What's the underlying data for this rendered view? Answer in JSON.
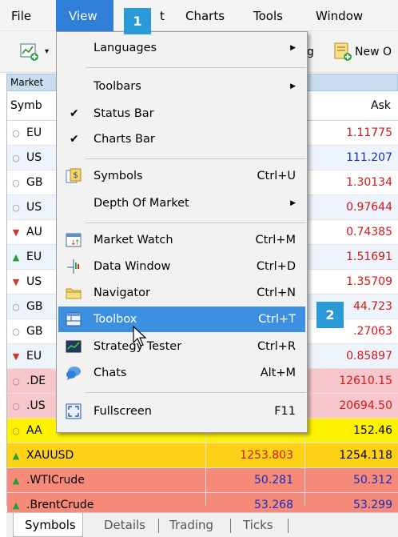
{
  "menubar": {
    "items": [
      "File",
      "View",
      "t",
      "Charts",
      "Tools",
      "Window"
    ]
  },
  "toolbar": {
    "partial_text": "g",
    "new_order_label": "New O"
  },
  "market_watch": {
    "title": "Market",
    "columns": [
      "Symb",
      "Ask"
    ],
    "rows": [
      {
        "symbol": "EU",
        "bid": "",
        "ask": "1.11775",
        "dir": "neutral"
      },
      {
        "symbol": "US",
        "bid": "",
        "ask": "111.207",
        "dir": "neutral"
      },
      {
        "symbol": "GB",
        "bid": "",
        "ask": "1.30134",
        "dir": "neutral"
      },
      {
        "symbol": "US",
        "bid": "",
        "ask": "0.97644",
        "dir": "neutral"
      },
      {
        "symbol": "AU",
        "bid": "",
        "ask": "0.74385",
        "dir": "down"
      },
      {
        "symbol": "EU",
        "bid": "",
        "ask": "1.51691",
        "dir": "up"
      },
      {
        "symbol": "US",
        "bid": "",
        "ask": "1.35709",
        "dir": "down"
      },
      {
        "symbol": "GB",
        "bid": "",
        "ask": "44.723",
        "dir": "neutral"
      },
      {
        "symbol": "GB",
        "bid": "",
        "ask": ".27063",
        "dir": "neutral"
      },
      {
        "symbol": "EU",
        "bid": "",
        "ask": "0.85897",
        "dir": "down"
      },
      {
        "symbol": ".DE",
        "bid": "",
        "ask": "12610.15",
        "dir": "neutral"
      },
      {
        "symbol": ".US",
        "bid": "",
        "ask": "20694.50",
        "dir": "neutral"
      },
      {
        "symbol": "AA",
        "bid": "",
        "ask": "152.46",
        "dir": "neutral"
      },
      {
        "symbol": "XAUUSD",
        "bid": "1253.803",
        "ask": "1254.118",
        "dir": "up"
      },
      {
        "symbol": ".WTICrude",
        "bid": "50.281",
        "ask": "50.312",
        "dir": "up"
      },
      {
        "symbol": ".BrentCrude",
        "bid": "53.268",
        "ask": "53.299",
        "dir": "up"
      }
    ]
  },
  "tabs": [
    "Symbols",
    "Details",
    "Trading",
    "Ticks"
  ],
  "view_menu": {
    "items": [
      {
        "label": "Languages",
        "shortcut": "",
        "submenu": true
      },
      {
        "label": "Toolbars",
        "shortcut": "",
        "submenu": true
      },
      {
        "label": "Status Bar",
        "shortcut": "",
        "checked": true
      },
      {
        "label": "Charts Bar",
        "shortcut": "",
        "checked": true
      },
      {
        "label": "Symbols",
        "shortcut": "Ctrl+U"
      },
      {
        "label": "Depth Of Market",
        "shortcut": "",
        "submenu": true
      },
      {
        "label": "Market Watch",
        "shortcut": "Ctrl+M"
      },
      {
        "label": "Data Window",
        "shortcut": "Ctrl+D"
      },
      {
        "label": "Navigator",
        "shortcut": "Ctrl+N"
      },
      {
        "label": "Toolbox",
        "shortcut": "Ctrl+T"
      },
      {
        "label": "Strategy Tester",
        "shortcut": "Ctrl+R"
      },
      {
        "label": "Chats",
        "shortcut": "Alt+M"
      },
      {
        "label": "Fullscreen",
        "shortcut": "F11"
      }
    ]
  },
  "callouts": [
    "1",
    "2"
  ],
  "colors": {
    "highlight": "#3d8fe0",
    "callout": "#2b9bd8",
    "ask_red": "#d01818",
    "ask_blue": "#1030c0"
  }
}
